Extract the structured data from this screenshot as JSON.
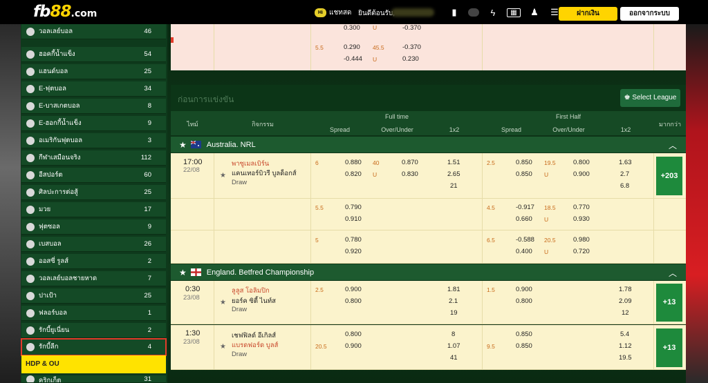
{
  "header": {
    "logo_main": "fb",
    "logo_num": "88",
    "logo_tld": ".com",
    "chat_badge": "Hi",
    "chat_label": "แชทสด",
    "welcome": "ยินดีต้อนรับ,",
    "deposit": "ฝากเงิน",
    "logout": "ออกจากระบบ"
  },
  "sidebar": {
    "items": [
      {
        "label": "วอลเลย์บอล",
        "count": "46"
      },
      {
        "label": "ฮอคกี้น้ำแข็ง",
        "count": "54"
      },
      {
        "label": "แฮนด์บอล",
        "count": "25"
      },
      {
        "label": "E-ฟุตบอล",
        "count": "34"
      },
      {
        "label": "E-บาสเกตบอล",
        "count": "8"
      },
      {
        "label": "E-ฮอกกี้น้ำแข็ง",
        "count": "9"
      },
      {
        "label": "อเมริกันฟุตบอล",
        "count": "3"
      },
      {
        "label": "กีฬาเสมือนจริง",
        "count": "112"
      },
      {
        "label": "อีสปอร์ต",
        "count": "60"
      },
      {
        "label": "ศิลปะการต่อสู้",
        "count": "25"
      },
      {
        "label": "มวย",
        "count": "17"
      },
      {
        "label": "ฟุตซอล",
        "count": "9"
      },
      {
        "label": "เบสบอล",
        "count": "26"
      },
      {
        "label": "ออสซี่ รูลส์",
        "count": "2"
      },
      {
        "label": "วอลเลย์บอลชายหาด",
        "count": "7"
      },
      {
        "label": "ปาเป้า",
        "count": "25"
      },
      {
        "label": "ฟลอร์บอล",
        "count": "1"
      },
      {
        "label": "รักบี้ยูเนี่ยน",
        "count": "2"
      },
      {
        "label": "รักบี้ลีก",
        "count": "4"
      }
    ],
    "hdp": "HDP & OU",
    "next_label": "คริกเก็ต",
    "next_count": "31"
  },
  "top_block": {
    "r0": {
      "a": "0.300",
      "b": "U",
      "c": "-0.370"
    },
    "r1": {
      "h": "5.5",
      "a": "0.290",
      "ou": "45.5",
      "c": "-0.370"
    },
    "r2": {
      "a": "-0.444",
      "b": "U",
      "c": "0.230"
    }
  },
  "section": {
    "title": "ก่อนการแข่งขัน",
    "select_league": "Select League",
    "col_time": "ไทม์",
    "col_event": "กิจกรรม",
    "full_time": "Full time",
    "first_half": "First Half",
    "spread": "Spread",
    "over_under": "Over/Under",
    "x12": "1x2",
    "more": "มากกว่า"
  },
  "leagues": [
    {
      "name": "Australia. NRL"
    },
    {
      "name": "England. Betfred Championship"
    }
  ],
  "matches": {
    "m1": {
      "time": "17:00",
      "date": "22/08",
      "home": "พาซูเมลเบิร์น",
      "away": "แคนเทอร์บิวรี บูลด็อกส์",
      "draw": "Draw",
      "ft_h": "6",
      "ft_s1": "0.880",
      "ft_s2": "0.820",
      "ft_ou": "40",
      "ft_u": "U",
      "ft_o1": "0.870",
      "ft_o2": "0.830",
      "ft_x1": "1.51",
      "ft_x2": "2.65",
      "ft_x3": "21",
      "fh_h": "2.5",
      "fh_s1": "0.850",
      "fh_s2": "0.850",
      "fh_ou": "19.5",
      "fh_u": "U",
      "fh_o1": "0.800",
      "fh_o2": "0.900",
      "fh_x1": "1.63",
      "fh_x2": "2.7",
      "fh_x3": "6.8",
      "more": "+203"
    },
    "m1b": {
      "ft_h": "5.5",
      "ft_s1": "0.790",
      "ft_s2": "0.910",
      "fh_h": "4.5",
      "fh_s1": "-0.917",
      "fh_s2": "0.660",
      "fh_ou": "18.5",
      "fh_u": "U",
      "fh_o1": "0.770",
      "fh_o2": "0.930"
    },
    "m1c": {
      "ft_h": "5",
      "ft_s1": "0.780",
      "ft_s2": "0.920",
      "fh_h": "6.5",
      "fh_s1": "-0.588",
      "fh_s2": "0.400",
      "fh_ou": "20.5",
      "fh_u": "U",
      "fh_o1": "0.980",
      "fh_o2": "0.720"
    },
    "m2": {
      "time": "0:30",
      "date": "23/08",
      "home": "ลูลูส โอลิมปิก",
      "away": "ยอร์ค ซิตี้ ไนท์ส",
      "draw": "Draw",
      "ft_h": "2.5",
      "ft_s1": "0.900",
      "ft_s2": "0.800",
      "ft_x1": "1.81",
      "ft_x2": "2.1",
      "ft_x3": "19",
      "fh_h": "1.5",
      "fh_s1": "0.900",
      "fh_s2": "0.800",
      "fh_x1": "1.78",
      "fh_x2": "2.09",
      "fh_x3": "12",
      "more": "+13"
    },
    "m3": {
      "time": "1:30",
      "date": "23/08",
      "home": "เชฟฟิลด์ อีเกิลส์",
      "away": "แบรดฟอร์ด บูลส์",
      "draw": "Draw",
      "ft_h": "20.5",
      "ft_s1": "0.800",
      "ft_s2": "0.900",
      "ft_x1": "8",
      "ft_x2": "1.07",
      "ft_x3": "41",
      "fh_h": "9.5",
      "fh_s1": "0.850",
      "fh_s2": "0.850",
      "fh_x1": "5.4",
      "fh_x2": "1.12",
      "fh_x3": "19.5",
      "more": "+13"
    }
  },
  "colors": {
    "accent": "#ffd400",
    "selected_outline": "#e23b2a",
    "more_button": "#1e8a3c",
    "row_bg": "#fbf3cc"
  }
}
